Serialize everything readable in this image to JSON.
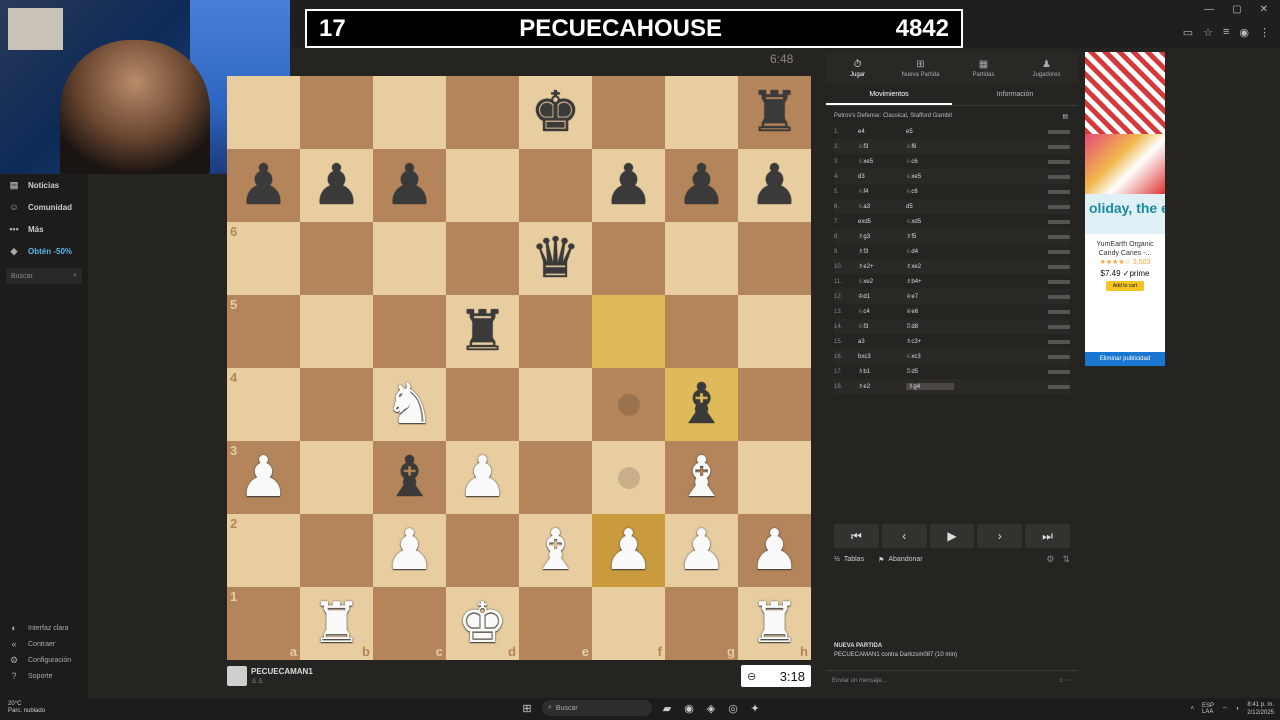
{
  "stream": {
    "left": "17",
    "name": "PECUECAHOUSE",
    "right": "4842"
  },
  "top_clock": "6:48",
  "sidebar": {
    "items": [
      {
        "label": "Noticias",
        "icon": "news-icon",
        "glyph": "▤"
      },
      {
        "label": "Comunidad",
        "icon": "community-icon",
        "glyph": "☺"
      },
      {
        "label": "Más",
        "icon": "more-icon",
        "glyph": "•••"
      },
      {
        "label": "Obtén -50%",
        "icon": "diamond-icon",
        "glyph": "◆"
      }
    ],
    "search_placeholder": "Buscar",
    "bottom": [
      {
        "label": "Interfaz clara",
        "icon": "theme-icon",
        "glyph": "◐"
      },
      {
        "label": "Contraer",
        "icon": "collapse-icon",
        "glyph": "«"
      },
      {
        "label": "Configuración",
        "icon": "settings-icon",
        "glyph": "⚙"
      },
      {
        "label": "Soporte",
        "icon": "help-icon",
        "glyph": "?"
      }
    ]
  },
  "board": {
    "rank_labels": [
      "6",
      "5",
      "4",
      "3",
      "2",
      "1"
    ],
    "file_labels": [
      "a",
      "b",
      "c",
      "d",
      "e",
      "f",
      "g",
      "h"
    ],
    "squares": [
      [
        "",
        "",
        "",
        "",
        "bK",
        "",
        "",
        "bR"
      ],
      [
        "bP",
        "bP",
        "bP",
        "",
        "",
        "bP",
        "bP",
        "bP"
      ],
      [
        "",
        "",
        "",
        "",
        "bQ",
        "",
        "",
        ""
      ],
      [
        "",
        "",
        "",
        "bR",
        "",
        "",
        "",
        ""
      ],
      [
        "",
        "",
        "wN",
        "",
        "",
        "",
        "bB",
        ""
      ],
      [
        "wP",
        "",
        "bB",
        "wP",
        "",
        "",
        "wB",
        ""
      ],
      [
        "",
        "",
        "wP",
        "",
        "wB",
        "wP",
        "wP",
        "wP"
      ],
      [
        "",
        "wR",
        "",
        "wK",
        "",
        "",
        "",
        "wR"
      ]
    ],
    "highlights": [
      [
        3,
        5
      ],
      [
        4,
        6
      ],
      [
        6,
        5
      ]
    ],
    "move_dots": [
      [
        4,
        5
      ],
      [
        5,
        5
      ]
    ]
  },
  "player": {
    "name": "PECUECAMAN1",
    "clock": "3:18"
  },
  "panel": {
    "tabs": [
      {
        "label": "Jugar",
        "icon": "stopwatch-icon",
        "glyph": "⏱"
      },
      {
        "label": "Nueva Partida",
        "icon": "plus-icon",
        "glyph": "⊞"
      },
      {
        "label": "Partidas",
        "icon": "grid-icon",
        "glyph": "▦"
      },
      {
        "label": "Jugadores",
        "icon": "players-icon",
        "glyph": "♟"
      }
    ],
    "subtabs": [
      "Movimientos",
      "Información"
    ],
    "opening": "Petrov's Defense: Classical, Stafford Gambit",
    "moves": [
      {
        "n": "1.",
        "w": "e4",
        "b": "e5"
      },
      {
        "n": "2.",
        "w": "♘f3",
        "b": "♘f6"
      },
      {
        "n": "3.",
        "w": "♘xe5",
        "b": "♘c6"
      },
      {
        "n": "4.",
        "w": "d3",
        "b": "♘xe5"
      },
      {
        "n": "5.",
        "w": "♘f4",
        "b": "♘c6"
      },
      {
        "n": "6.",
        "w": "♘a3",
        "b": "d5"
      },
      {
        "n": "7.",
        "w": "exd5",
        "b": "♘xd5"
      },
      {
        "n": "8.",
        "w": "♗g3",
        "b": "♗f5"
      },
      {
        "n": "9.",
        "w": "♗f3",
        "b": "♘d4"
      },
      {
        "n": "10.",
        "w": "♗e2+",
        "b": "♗xe2"
      },
      {
        "n": "11.",
        "w": "♘xe2",
        "b": "♗b4+"
      },
      {
        "n": "12.",
        "w": "♔d1",
        "b": "♕e7"
      },
      {
        "n": "13.",
        "w": "♘c4",
        "b": "♕e6"
      },
      {
        "n": "14.",
        "w": "♘f3",
        "b": "♖d8"
      },
      {
        "n": "15.",
        "w": "a3",
        "b": "♗c3+"
      },
      {
        "n": "16.",
        "w": "bxc3",
        "b": "♘xc3"
      },
      {
        "n": "17.",
        "w": "♗b1",
        "b": "♖d5"
      },
      {
        "n": "18.",
        "w": "♗e2",
        "b": "♗g4"
      }
    ],
    "actions": {
      "draw": "Tablas",
      "resign": "Abandonar"
    },
    "new_game": {
      "title": "NUEVA PARTIDA",
      "detail": "PECUECAMAN1 contra Darkzsm087 (10 min)"
    },
    "chat_placeholder": "Enviar un mensaje..."
  },
  "ad": {
    "banner": "oliday, the ergy-friend",
    "product": "YumEarth Organic Candy Canes -...",
    "rating": "★★★★☆ 3,503",
    "price": "$7.49 ✓prime",
    "cart": "Add to cart",
    "remove": "Eliminar publicidad"
  },
  "taskbar": {
    "weather_temp": "20°C",
    "weather_desc": "Parc. nublado",
    "search": "Buscar",
    "lang": "ESP",
    "lang2": "LAA",
    "time": "8:41 p. m.",
    "date": "2/12/2025"
  }
}
